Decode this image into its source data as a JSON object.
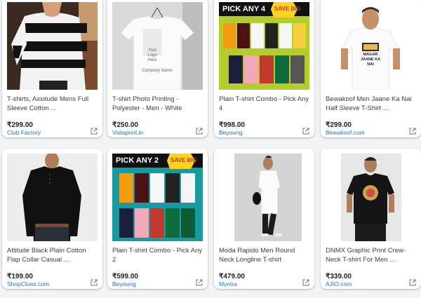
{
  "products": [
    {
      "title": "T-shirts, Axxitude Mens Full Sleeve Cotton ...",
      "price": "₹299.00",
      "source": "Club Factory"
    },
    {
      "title": "T-shirt Photo Printing - Polyester - Men - White",
      "price": "₹250.00",
      "source": "Vistaprint.in",
      "logo_text": "Your Logo Here",
      "company_text": "Company Name"
    },
    {
      "title": "Plain T-shirt Combo - Pick Any 4",
      "price": "₹998.00",
      "source": "Beyoung",
      "banner": "PICK ANY 4",
      "badge": "SAVE BIG"
    },
    {
      "title": "Bewakoof Men Jaane Ka Nai Half Sleeve T-Shirt ...",
      "price": "₹299.00",
      "source": "Bewakoof.com",
      "print_text": "MAGAR JAANE KA NAI"
    },
    {
      "title": "Attitude Black Plain Cotton Flap Collar Casual ...",
      "price": "₹199.00",
      "source": "ShopClues.com"
    },
    {
      "title": "Plain T-shirt Combo - Pick Any 2",
      "price": "₹599.00",
      "source": "Beyoung",
      "banner": "PICK ANY 2",
      "badge": "SAVE BIG"
    },
    {
      "title": "Moda Rapido Men Round Neck Longline T-shirt",
      "price": "₹479.00",
      "source": "Myntra"
    },
    {
      "title": "DNMX Graphic Print Crew-Neck T-shirt For Men ...",
      "price": "₹339.00",
      "source": "AJIO.com"
    }
  ],
  "colors": {
    "link": "#1a73e8",
    "price": "#202124",
    "title": "#3c4043",
    "banner_yellow": "#ffd21f",
    "banner_green": "#b5cc2e",
    "banner_teal": "#1a9aa0"
  }
}
